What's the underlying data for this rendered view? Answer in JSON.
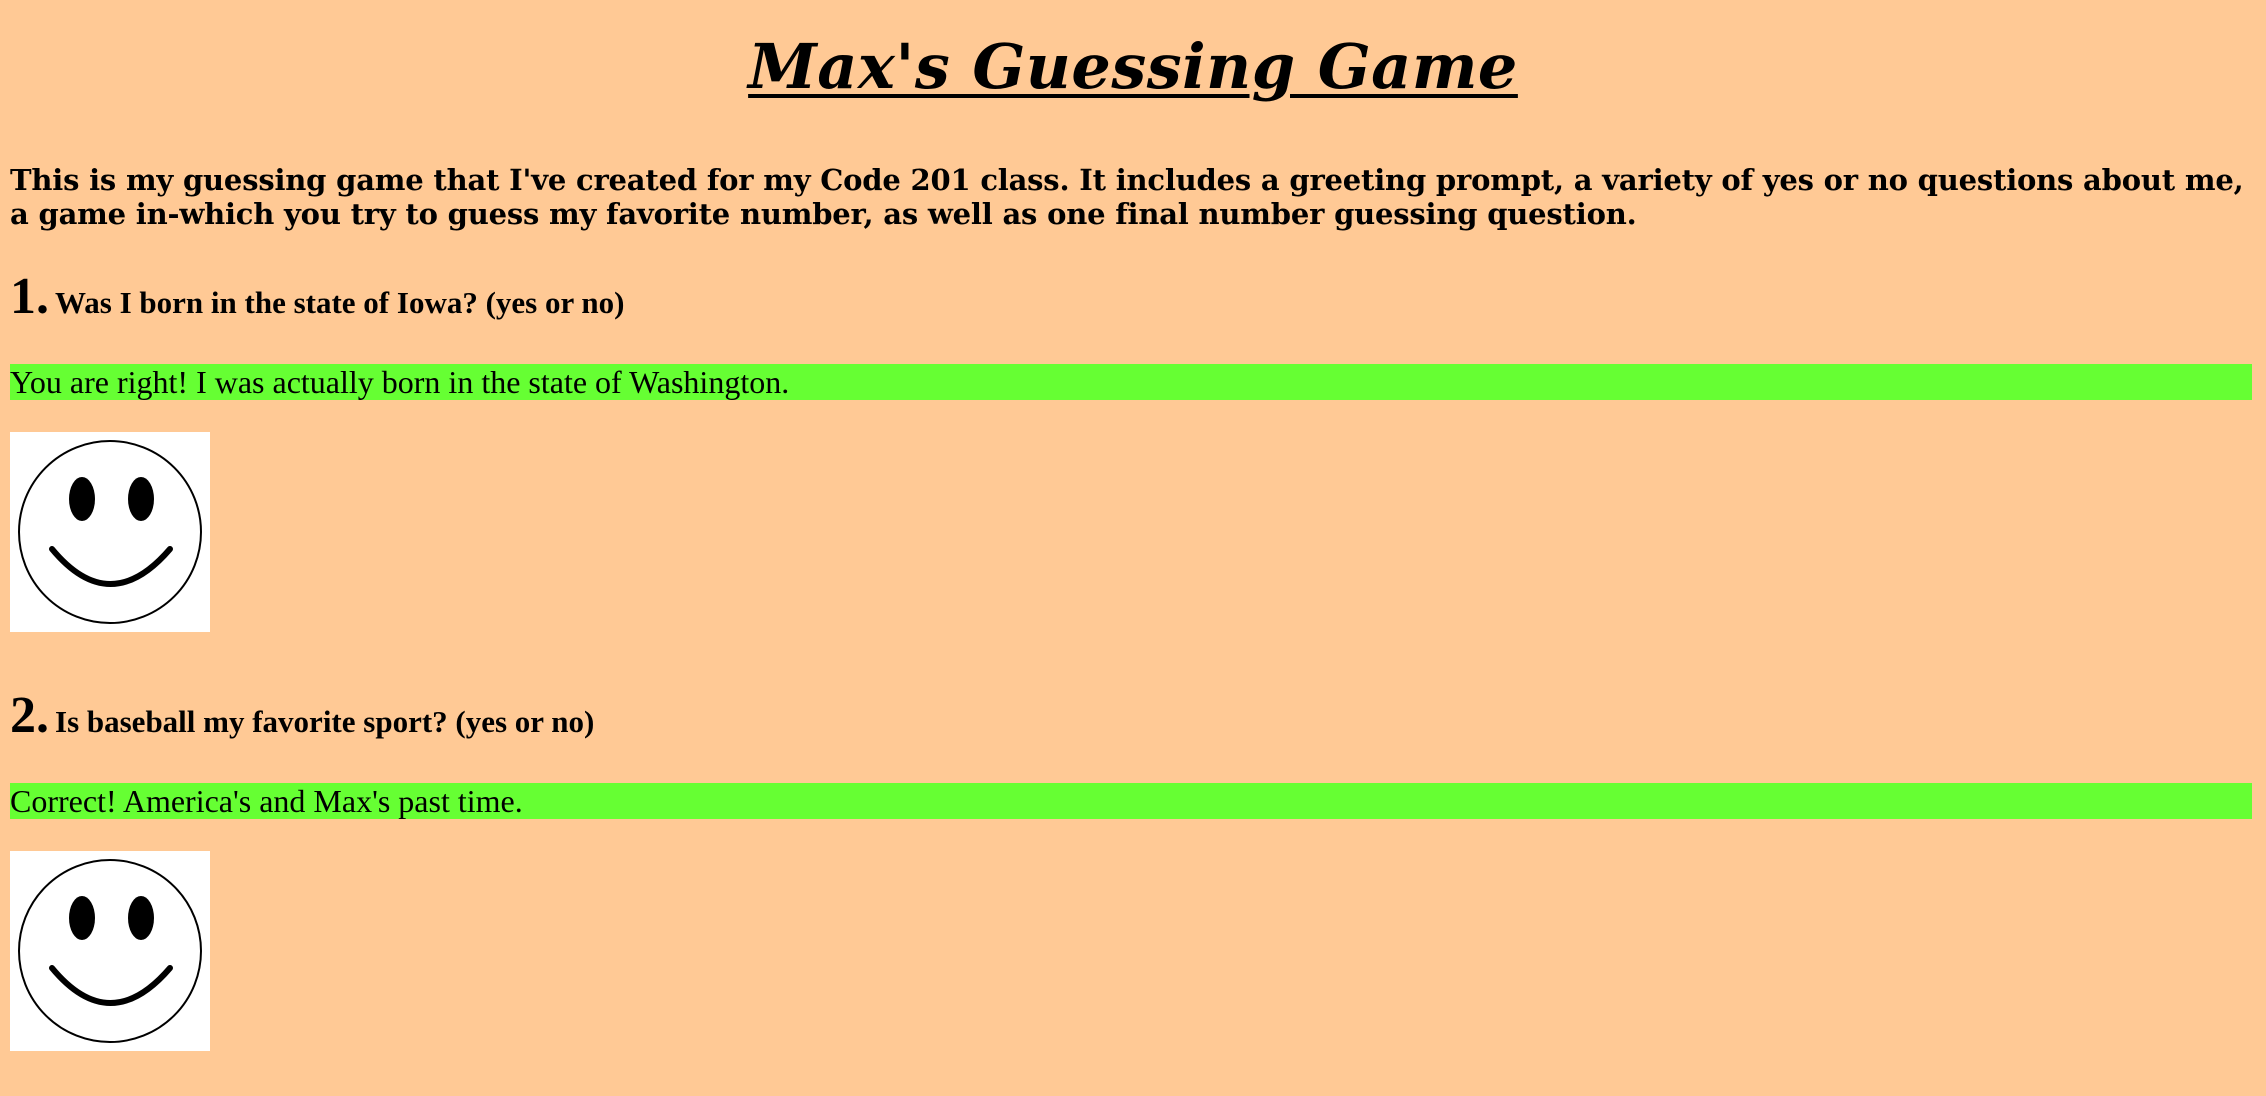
{
  "page": {
    "title": "Max's Guessing Game",
    "intro": "This is my guessing game that I've created for my Code 201 class. It includes a greeting prompt, a variety of yes or no questions about me, a game in-which you try to guess my favorite number, as well as one final number guessing question.",
    "background_color": "#ffc995",
    "answer_highlight_color": "#66ff33"
  },
  "questions": [
    {
      "number": "1.",
      "text": "Was I born in the state of Iowa? (yes or no)",
      "answer": "You are right! I was actually born in the state of Washington.",
      "image_icon": "smiley-face-icon"
    },
    {
      "number": "2.",
      "text": "Is baseball my favorite sport? (yes or no)",
      "answer": "Correct! America's and Max's past time.",
      "image_icon": "smiley-face-icon"
    }
  ]
}
